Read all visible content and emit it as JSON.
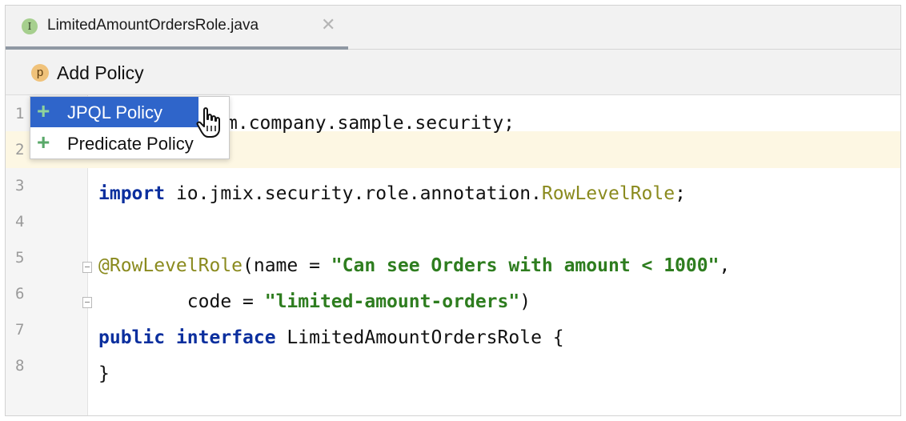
{
  "tab": {
    "icon_letter": "I",
    "title": "LimitedAmountOrdersRole.java",
    "close_icon": "close-icon"
  },
  "toolbar": {
    "action_icon_letter": "p",
    "action_label": "Add Policy"
  },
  "popup": {
    "items": [
      {
        "label": "JPQL Policy",
        "icon": "plus-icon",
        "selected": true
      },
      {
        "label": "Predicate Policy",
        "icon": "plus-icon",
        "selected": false
      }
    ]
  },
  "editor": {
    "line_numbers": [
      "1",
      "2",
      "3",
      "4",
      "5",
      "6",
      "7",
      "8"
    ],
    "lines": {
      "l1": "m.company.sample.security;",
      "l3_kw": "import",
      "l3_pkg": " io.jmix.security.role.annotation.",
      "l3_ann": "RowLevelRole",
      "l3_end": ";",
      "l5_ann": "@RowLevelRole",
      "l5_mid": "(name = ",
      "l5_str": "\"Can see Orders with amount < 1000\"",
      "l5_end": ",",
      "l6_pre": "        code = ",
      "l6_str": "\"limited-amount-orders\"",
      "l6_end": ")",
      "l7_kw1": "public",
      "l7_kw2": "interface",
      "l7_name": " LimitedAmountOrdersRole {",
      "l8": "}"
    }
  },
  "colors": {
    "selection": "#2f65ca",
    "keyword": "#0b2f9e",
    "string": "#2e7d1f",
    "annotation": "#8a8a1e",
    "caret_row": "#fdf7e3"
  }
}
